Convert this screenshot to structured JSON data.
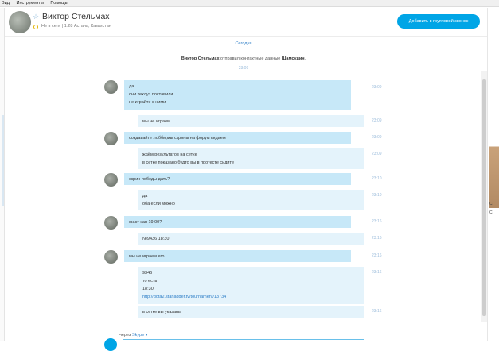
{
  "menubar": {
    "items": [
      "Вид",
      "Инструменты",
      "Помощь"
    ]
  },
  "header": {
    "contact_name": "Виктор Стельмах",
    "status": "Не в сети | 1:28 Астана, Казахстан",
    "call_button": "Добавить в групповой звонок"
  },
  "chat": {
    "date_separator": "Сегодня",
    "system_message": {
      "sender": "Виктор Стельмах",
      "text": " отправил контактные данные ",
      "contact": "Шамсудин",
      "end": ".",
      "time": "23:09"
    },
    "messages": [
      {
        "side": "them",
        "lines": [
          "да",
          "они техлуз поставили",
          "не играйте с ними"
        ],
        "time": "23:09"
      },
      {
        "side": "me",
        "lines": [
          "мы не играем"
        ],
        "time": "23:09"
      },
      {
        "side": "them",
        "lines": [
          "создавайте лобби,мы скрины на форум кидаем"
        ],
        "time": "23:09"
      },
      {
        "side": "me",
        "lines": [
          "ждём результатов на сетке",
          "в сетке показано будто вы в протесте сидите"
        ],
        "time": "23:09"
      },
      {
        "side": "them",
        "lines": [
          "скрин победы дать?"
        ],
        "time": "23:10"
      },
      {
        "side": "me",
        "lines": [
          "да",
          "оба если можно"
        ],
        "time": "23:10"
      },
      {
        "side": "them",
        "lines": [
          "фаст кап 19:00?"
        ],
        "time": "23:16"
      },
      {
        "side": "me",
        "lines": [
          "№9436 18:30"
        ],
        "time": "23:16"
      },
      {
        "side": "them",
        "lines": [
          "мы не играем его"
        ],
        "time": "23:16"
      },
      {
        "side": "me",
        "lines": [
          "9346",
          "то есть",
          "18:30",
          "http://dota2.starladder.tv/tournament/13734"
        ],
        "time": "23:16"
      },
      {
        "side": "me",
        "lines": [
          "в сетке вы указаны"
        ],
        "time": "23:16"
      }
    ],
    "via_label": "через ",
    "via_service": "Skype ▾"
  },
  "colors": {
    "accent": "#00a5e6",
    "bubble_dark": "#c7e8f8",
    "bubble_light": "#e4f3fb"
  },
  "right_pane": {
    "fragments": [
      "С",
      "С"
    ]
  }
}
